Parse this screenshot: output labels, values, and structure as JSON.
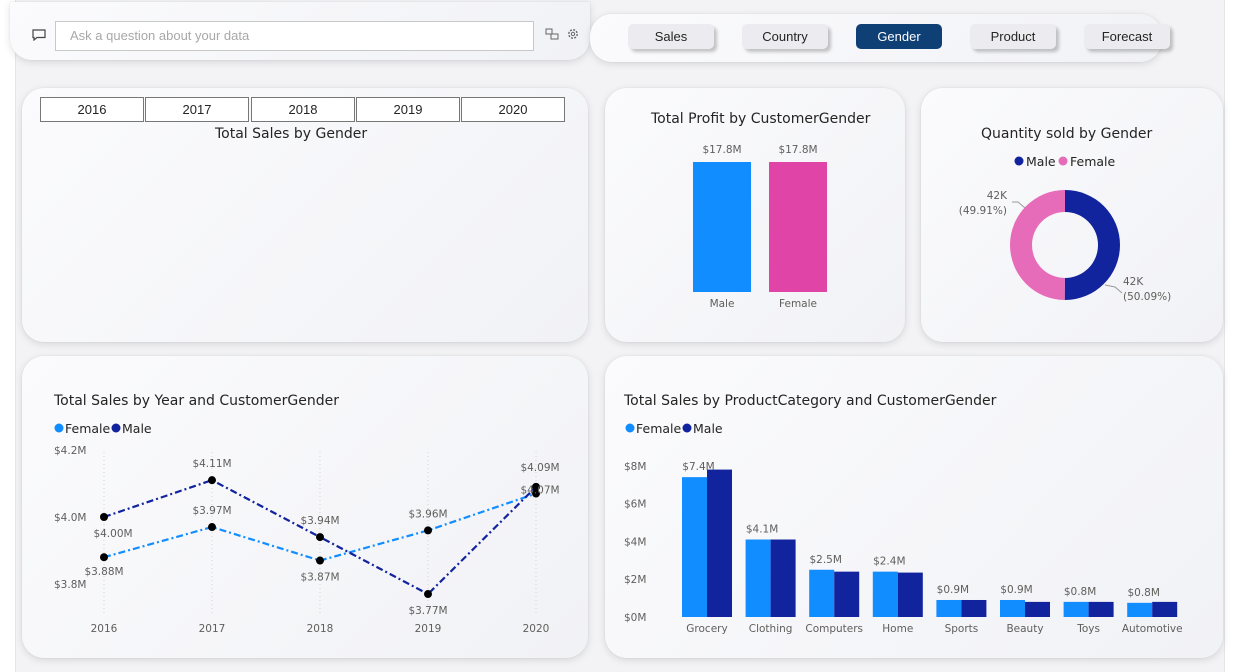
{
  "qa": {
    "placeholder": "Ask a question about your data",
    "icon": "chat-icon",
    "tools": [
      "qa-explore-icon",
      "gear-icon"
    ]
  },
  "nav": {
    "buttons": [
      {
        "label": "Sales"
      },
      {
        "label": "Country"
      },
      {
        "label": "Gender"
      },
      {
        "label": "Product"
      },
      {
        "label": "Forecast"
      }
    ],
    "active": "Gender",
    "active_color": "#0e3f75"
  },
  "year_slicer": {
    "years": [
      "2016",
      "2017",
      "2018",
      "2019",
      "2020"
    ]
  },
  "colors": {
    "male_light": "#118dff",
    "male_dark": "#12239e",
    "female_pink": "#e044a7",
    "female_light": "#118dff"
  },
  "chart_data": [
    {
      "id": "total_sales_by_gender",
      "type": "bar",
      "title": "Total Sales by Gender",
      "categories": [],
      "values": []
    },
    {
      "id": "profit_by_gender",
      "type": "bar",
      "title": "Total Profit by CustomerGender",
      "categories": [
        "Male",
        "Female"
      ],
      "values": [
        17.8,
        17.8
      ],
      "data_labels": [
        "$17.8M",
        "$17.8M"
      ],
      "colors": [
        "#118dff",
        "#e044a7"
      ],
      "grid": false
    },
    {
      "id": "qty_by_gender",
      "type": "pie",
      "title": "Quantity sold by Gender",
      "legend": [
        "Male",
        "Female"
      ],
      "legend_position": "top-center",
      "categories": [
        "Male",
        "Female"
      ],
      "values": [
        50.09,
        49.91
      ],
      "data_labels": [
        {
          "value": "42K",
          "percent": "(50.09%)"
        },
        {
          "value": "42K",
          "percent": "(49.91%)"
        }
      ],
      "colors": [
        "#12239e",
        "#e66cb9"
      ]
    },
    {
      "id": "sales_by_year_gender",
      "type": "line",
      "title": "Total Sales by Year and CustomerGender",
      "legend": [
        "Female",
        "Male"
      ],
      "legend_position": "top-left",
      "x": [
        "2016",
        "2017",
        "2018",
        "2019",
        "2020"
      ],
      "series": [
        {
          "name": "Female",
          "values": [
            3.88,
            3.97,
            3.87,
            3.96,
            4.07
          ],
          "labels": [
            "$3.88M",
            "$3.97M",
            "$3.87M",
            "$3.96M",
            "$4.07M"
          ],
          "color": "#118dff"
        },
        {
          "name": "Male",
          "values": [
            4.0,
            4.11,
            3.94,
            3.77,
            4.09
          ],
          "labels": [
            "$4.00M",
            "$4.11M",
            "$3.94M",
            "$3.77M",
            "$4.09M"
          ],
          "color": "#12239e"
        }
      ],
      "yticks": [
        "$3.8M",
        "$4.0M",
        "$4.2M"
      ],
      "ylim": [
        3.7,
        4.2
      ]
    },
    {
      "id": "sales_by_category_gender",
      "type": "bar",
      "title": "Total Sales by ProductCategory and CustomerGender",
      "legend": [
        "Female",
        "Male"
      ],
      "legend_position": "top-left",
      "categories": [
        "Grocery",
        "Clothing",
        "Computers",
        "Home",
        "Sports",
        "Beauty",
        "Toys",
        "Automotive"
      ],
      "series": [
        {
          "name": "Female",
          "values": [
            7.4,
            4.1,
            2.5,
            2.4,
            0.9,
            0.9,
            0.8,
            0.75
          ],
          "color": "#118dff"
        },
        {
          "name": "Male",
          "values": [
            7.8,
            4.1,
            2.4,
            2.35,
            0.9,
            0.8,
            0.8,
            0.8
          ],
          "color": "#12239e"
        }
      ],
      "data_labels": [
        "$7.4M",
        "$4.1M",
        "$2.5M",
        "$2.4M",
        "$0.9M",
        "$0.9M",
        "$0.8M",
        "$0.8M"
      ],
      "yticks": [
        "$0M",
        "$2M",
        "$4M",
        "$6M",
        "$8M"
      ],
      "ylim": [
        0,
        8
      ]
    }
  ]
}
